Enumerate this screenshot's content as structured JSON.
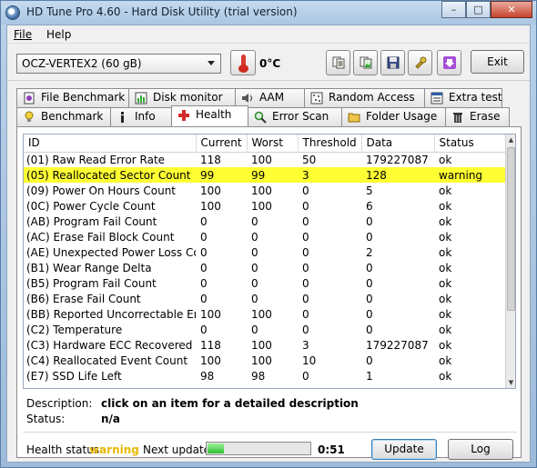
{
  "window": {
    "title": "HD Tune Pro 4.60 - Hard Disk Utility (trial version)",
    "controls": [
      "–",
      "□",
      "✕"
    ]
  },
  "menu": {
    "file": "File",
    "help": "Help"
  },
  "toolbar": {
    "drive": "OCZ-VERTEX2 (60 gB)",
    "temperature": "0°C",
    "icons": [
      "copy-text-icon",
      "copy-image-icon",
      "save-icon",
      "options-icon",
      "download-icon"
    ],
    "exit_label": "Exit"
  },
  "tabs": {
    "top": [
      {
        "label": "File Benchmark",
        "icon": "file-benchmark-icon"
      },
      {
        "label": "Disk monitor",
        "icon": "disk-monitor-icon"
      },
      {
        "label": "AAM",
        "icon": "speaker-icon"
      },
      {
        "label": "Random Access",
        "icon": "random-access-icon"
      },
      {
        "label": "Extra tests",
        "icon": "extra-tests-icon"
      }
    ],
    "bottom": [
      {
        "label": "Benchmark",
        "icon": "lightbulb-icon"
      },
      {
        "label": "Info",
        "icon": "info-icon"
      },
      {
        "label": "Health",
        "icon": "health-cross-icon"
      },
      {
        "label": "Error Scan",
        "icon": "magnifier-icon"
      },
      {
        "label": "Folder Usage",
        "icon": "folder-icon"
      },
      {
        "label": "Erase",
        "icon": "trash-icon"
      }
    ],
    "active": "Health"
  },
  "health_table": {
    "columns": [
      "ID",
      "Current",
      "Worst",
      "Threshold",
      "Data",
      "Status"
    ],
    "rows": [
      {
        "id": "(01) Raw Read Error Rate",
        "current": "118",
        "worst": "100",
        "threshold": "50",
        "data": "179227087",
        "status": "ok",
        "warn": false
      },
      {
        "id": "(05) Reallocated Sector Count",
        "current": "99",
        "worst": "99",
        "threshold": "3",
        "data": "128",
        "status": "warning",
        "warn": true
      },
      {
        "id": "(09) Power On Hours Count",
        "current": "100",
        "worst": "100",
        "threshold": "0",
        "data": "5",
        "status": "ok",
        "warn": false
      },
      {
        "id": "(0C) Power Cycle Count",
        "current": "100",
        "worst": "100",
        "threshold": "0",
        "data": "6",
        "status": "ok",
        "warn": false
      },
      {
        "id": "(AB) Program Fail Count",
        "current": "0",
        "worst": "0",
        "threshold": "0",
        "data": "0",
        "status": "ok",
        "warn": false
      },
      {
        "id": "(AC) Erase Fail Block Count",
        "current": "0",
        "worst": "0",
        "threshold": "0",
        "data": "0",
        "status": "ok",
        "warn": false
      },
      {
        "id": "(AE) Unexpected Power Loss Count",
        "current": "0",
        "worst": "0",
        "threshold": "0",
        "data": "2",
        "status": "ok",
        "warn": false
      },
      {
        "id": "(B1) Wear Range Delta",
        "current": "0",
        "worst": "0",
        "threshold": "0",
        "data": "0",
        "status": "ok",
        "warn": false
      },
      {
        "id": "(B5) Program Fail Count",
        "current": "0",
        "worst": "0",
        "threshold": "0",
        "data": "0",
        "status": "ok",
        "warn": false
      },
      {
        "id": "(B6) Erase Fail Count",
        "current": "0",
        "worst": "0",
        "threshold": "0",
        "data": "0",
        "status": "ok",
        "warn": false
      },
      {
        "id": "(BB) Reported Uncorrectable Errors",
        "current": "100",
        "worst": "100",
        "threshold": "0",
        "data": "0",
        "status": "ok",
        "warn": false
      },
      {
        "id": "(C2) Temperature",
        "current": "0",
        "worst": "0",
        "threshold": "0",
        "data": "0",
        "status": "ok",
        "warn": false
      },
      {
        "id": "(C3) Hardware ECC Recovered",
        "current": "118",
        "worst": "100",
        "threshold": "3",
        "data": "179227087",
        "status": "ok",
        "warn": false
      },
      {
        "id": "(C4) Reallocated Event Count",
        "current": "100",
        "worst": "100",
        "threshold": "10",
        "data": "0",
        "status": "ok",
        "warn": false
      },
      {
        "id": "(E7) SSD Life Left",
        "current": "98",
        "worst": "98",
        "threshold": "0",
        "data": "1",
        "status": "ok",
        "warn": false
      }
    ],
    "scroll": {
      "up": "▲",
      "down": "▼"
    }
  },
  "details": {
    "description_label": "Description:",
    "description_value": "click on an item for a detailed description",
    "status_label": "Status:",
    "status_value": "n/a"
  },
  "footer": {
    "health_label": "Health status:",
    "health_value": "warning",
    "next_update_label": "Next update:",
    "progress_fraction": 0.16,
    "countdown": "0:51",
    "update_label": "Update",
    "log_label": "Log"
  },
  "colors": {
    "warning_row": "#ffff33",
    "health_warning": "#e8b800",
    "progress_fill": "#2fbe2f"
  }
}
